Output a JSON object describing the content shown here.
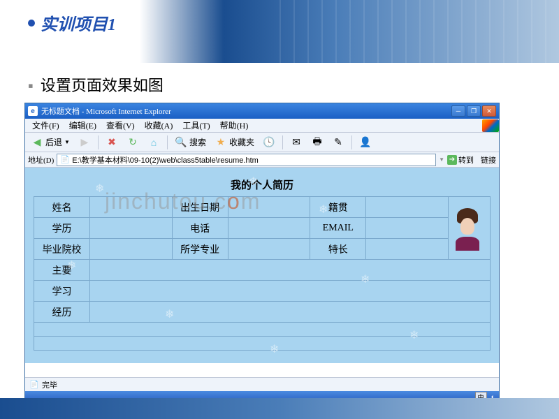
{
  "slide": {
    "title": "实训项目1",
    "subtitle": "设置页面效果如图"
  },
  "window": {
    "title": "无标题文档 - Microsoft Internet Explorer",
    "menus": [
      "文件(F)",
      "编辑(E)",
      "查看(V)",
      "收藏(A)",
      "工具(T)",
      "帮助(H)"
    ],
    "toolbar": {
      "back": "后退",
      "search": "搜索",
      "favorites": "收藏夹"
    },
    "address_label": "地址(D)",
    "address": "E:\\教学基本材料\\09-10(2)\\web\\class5table\\resume.htm",
    "go": "转到",
    "links": "链接"
  },
  "resume": {
    "title": "我的个人简历",
    "rows": [
      {
        "c1": "姓名",
        "c2": "出生日期",
        "c3": "籍贯"
      },
      {
        "c1": "学历",
        "c2": "电话",
        "c3": "EMAIL"
      },
      {
        "c1": "毕业院校",
        "c2": "所学专业",
        "c3": "特长"
      }
    ],
    "section": [
      "主要",
      "学习",
      "经历"
    ]
  },
  "status": {
    "done": "完毕",
    "lang": "中"
  },
  "watermark": "jinchutou.com"
}
